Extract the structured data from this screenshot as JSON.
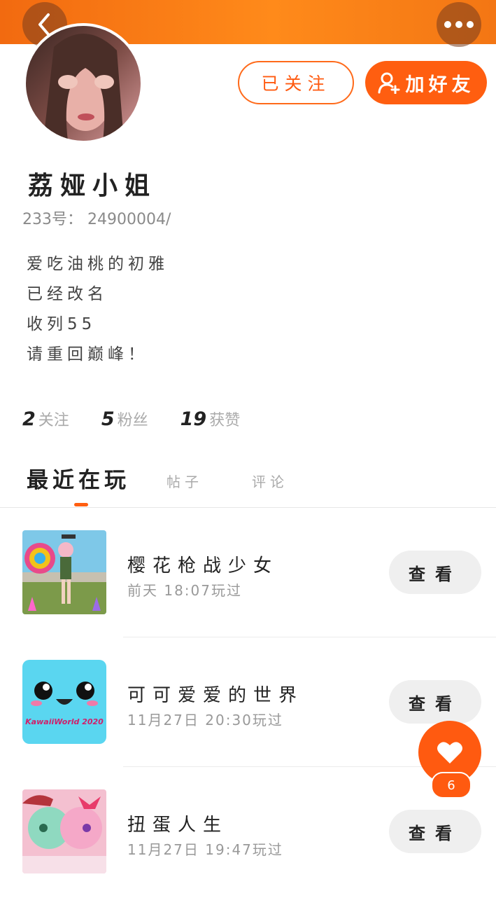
{
  "header": {
    "back_icon": "chevron-left-icon",
    "more_icon": "more-dots-icon"
  },
  "profile": {
    "name": "荔娅小姐",
    "id_line": "233号：  24900004/",
    "bio": [
      "爱吃油桃的初雅",
      "已经改名",
      "收列55",
      "请重回巅峰！"
    ]
  },
  "actions": {
    "followed_label": "已关注",
    "add_friend_label": "加好友"
  },
  "stats": [
    {
      "value": "2",
      "label": "关注"
    },
    {
      "value": "5",
      "label": "粉丝"
    },
    {
      "value": "19",
      "label": "获赞"
    }
  ],
  "tabs": [
    {
      "label": "最近在玩",
      "active": true
    },
    {
      "label": "帖子",
      "active": false
    },
    {
      "label": "评论",
      "active": false
    }
  ],
  "games": [
    {
      "title": "樱花枪战少女",
      "meta": "前天 18:07玩过",
      "button": "查看"
    },
    {
      "title": "可可爱爱的世界",
      "meta": "11月27日 20:30玩过",
      "button": "查看",
      "thumb_text": "KawaiiWorld 2020"
    },
    {
      "title": "扭蛋人生",
      "meta": "11月27日 19:47玩过",
      "button": "查看"
    }
  ],
  "like": {
    "count": "6"
  },
  "colors": {
    "accent": "#ff5e10",
    "banner": "#f57a18"
  }
}
